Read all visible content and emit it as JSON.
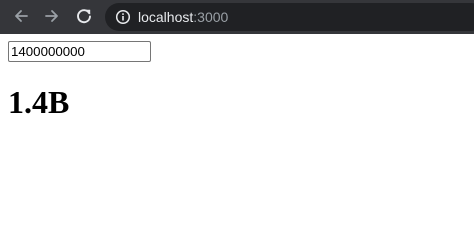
{
  "browser": {
    "url_host": "localhost",
    "url_port": ":3000",
    "icons": {
      "back": "arrow-left-icon",
      "forward": "arrow-right-icon",
      "reload": "reload-icon",
      "info": "info-icon"
    },
    "colors": {
      "toolbar_bg": "#35363a",
      "omnibox_bg": "#202124",
      "host_text": "#e8eaed",
      "port_text": "#9aa0a6"
    }
  },
  "page": {
    "input_value": "1400000000",
    "formatted_result": "1.4B"
  }
}
